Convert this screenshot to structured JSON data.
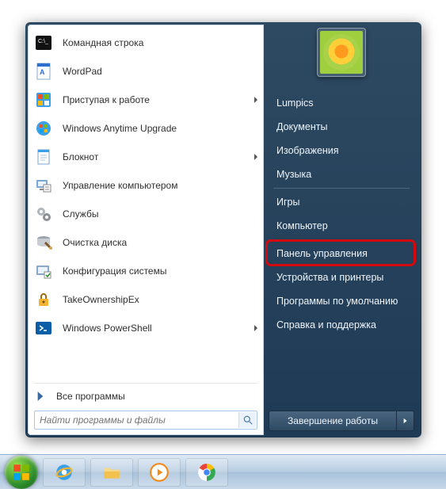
{
  "programs": [
    {
      "label": "Командная строка",
      "icon": "cmd-icon",
      "submenu": false
    },
    {
      "label": "WordPad",
      "icon": "wordpad-icon",
      "submenu": false
    },
    {
      "label": "Приступая к работе",
      "icon": "getting-started-icon",
      "submenu": true
    },
    {
      "label": "Windows Anytime Upgrade",
      "icon": "anytime-upgrade-icon",
      "submenu": false
    },
    {
      "label": "Блокнот",
      "icon": "notepad-icon",
      "submenu": true
    },
    {
      "label": "Управление компьютером",
      "icon": "computer-mgmt-icon",
      "submenu": false
    },
    {
      "label": "Службы",
      "icon": "services-icon",
      "submenu": false
    },
    {
      "label": "Очистка диска",
      "icon": "disk-cleanup-icon",
      "submenu": false
    },
    {
      "label": "Конфигурация системы",
      "icon": "msconfig-icon",
      "submenu": false
    },
    {
      "label": "TakeOwnershipEx",
      "icon": "takeownership-icon",
      "submenu": false
    },
    {
      "label": "Windows PowerShell",
      "icon": "powershell-icon",
      "submenu": true
    }
  ],
  "all_programs_label": "Все программы",
  "search": {
    "placeholder": "Найти программы и файлы"
  },
  "right_groups": [
    [
      {
        "label": "Lumpics",
        "name": "user-folder"
      },
      {
        "label": "Документы",
        "name": "documents"
      },
      {
        "label": "Изображения",
        "name": "pictures"
      },
      {
        "label": "Музыка",
        "name": "music"
      }
    ],
    [
      {
        "label": "Игры",
        "name": "games"
      },
      {
        "label": "Компьютер",
        "name": "computer"
      }
    ],
    [
      {
        "label": "Панель управления",
        "name": "control-panel",
        "highlight": true
      },
      {
        "label": "Устройства и принтеры",
        "name": "devices-printers"
      },
      {
        "label": "Программы по умолчанию",
        "name": "default-programs"
      },
      {
        "label": "Справка и поддержка",
        "name": "help-support"
      }
    ]
  ],
  "shutdown_label": "Завершение работы",
  "taskbar_pinned": [
    {
      "name": "internet-explorer-icon"
    },
    {
      "name": "file-explorer-icon"
    },
    {
      "name": "media-player-icon"
    },
    {
      "name": "chrome-icon"
    }
  ],
  "icon_colors": {
    "cmd-icon": "#1a1a1a",
    "wordpad-icon": "#2f6fd0",
    "getting-started-icon": "#3aa0e8",
    "anytime-upgrade-icon": "#3aa0e8",
    "notepad-icon": "#3aa0e8",
    "computer-mgmt-icon": "#7aa7d4",
    "services-icon": "#b0b6bd",
    "disk-cleanup-icon": "#d9a64a",
    "msconfig-icon": "#8aa8c8",
    "takeownership-icon": "#f2b430",
    "powershell-icon": "#0a5ea8"
  }
}
